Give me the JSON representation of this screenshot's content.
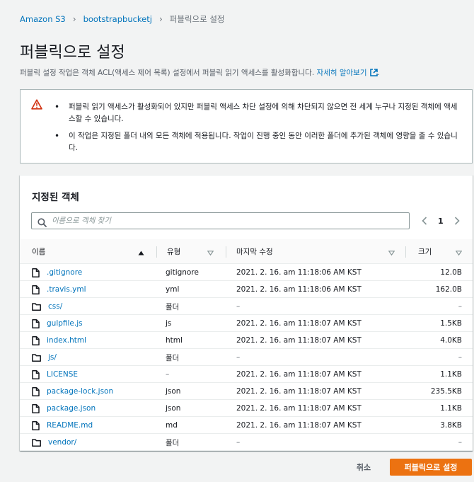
{
  "breadcrumb": [
    "Amazon S3",
    "bootstrapbucketj",
    "퍼블릭으로 설정"
  ],
  "title": "퍼블릭으로 설정",
  "description": {
    "text": "퍼블릭 설정 작업은 객체 ACL(액세스 제어 목록) 설정에서 퍼블릭 읽기 액세스를 활성화합니다.",
    "link": "자세히 알아보기"
  },
  "warning": {
    "items": [
      "퍼블릭 읽기 액세스가 활성화되어 있지만 퍼블릭 액세스 차단 설정에 의해 차단되지 않으면 전 세계 누구나 지정된 객체에 액세스할 수 있습니다.",
      "이 작업은 지정된 폴더 내의 모든 객체에 적용됩니다. 작업이 진행 중인 동안 이러한 폴더에 추가된 객체에 영향을 줄 수 있습니다."
    ]
  },
  "panel": {
    "title": "지정된 객체",
    "search_placeholder": "이름으로 객체 찾기",
    "page": "1",
    "columns": {
      "name": "이름",
      "type": "유형",
      "modified": "마지막 수정",
      "size": "크기"
    },
    "rows": [
      {
        "name": ".gitignore",
        "icon": "file-icon",
        "type": "gitignore",
        "modified": "2021. 2. 16. am 11:18:06 AM KST",
        "size": "12.0B"
      },
      {
        "name": ".travis.yml",
        "icon": "file-icon",
        "type": "yml",
        "modified": "2021. 2. 16. am 11:18:06 AM KST",
        "size": "162.0B"
      },
      {
        "name": "css/",
        "icon": "folder-icon",
        "type": "폴더",
        "modified": "–",
        "size": "–"
      },
      {
        "name": "gulpfile.js",
        "icon": "file-icon",
        "type": "js",
        "modified": "2021. 2. 16. am 11:18:07 AM KST",
        "size": "1.5KB"
      },
      {
        "name": "index.html",
        "icon": "file-icon",
        "type": "html",
        "modified": "2021. 2. 16. am 11:18:07 AM KST",
        "size": "4.0KB"
      },
      {
        "name": "js/",
        "icon": "folder-icon",
        "type": "폴더",
        "modified": "–",
        "size": "–"
      },
      {
        "name": "LICENSE",
        "icon": "file-icon",
        "type": "–",
        "modified": "2021. 2. 16. am 11:18:07 AM KST",
        "size": "1.1KB"
      },
      {
        "name": "package-lock.json",
        "icon": "file-icon",
        "type": "json",
        "modified": "2021. 2. 16. am 11:18:07 AM KST",
        "size": "235.5KB"
      },
      {
        "name": "package.json",
        "icon": "file-icon",
        "type": "json",
        "modified": "2021. 2. 16. am 11:18:07 AM KST",
        "size": "1.1KB"
      },
      {
        "name": "README.md",
        "icon": "file-icon",
        "type": "md",
        "modified": "2021. 2. 16. am 11:18:07 AM KST",
        "size": "3.8KB"
      },
      {
        "name": "vendor/",
        "icon": "folder-icon",
        "type": "폴더",
        "modified": "–",
        "size": "–"
      }
    ]
  },
  "footer": {
    "cancel": "취소",
    "submit": "퍼블릭으로 설정"
  },
  "colors": {
    "link": "#0073bb",
    "primary": "#ec7211",
    "warning": "#d13212"
  }
}
